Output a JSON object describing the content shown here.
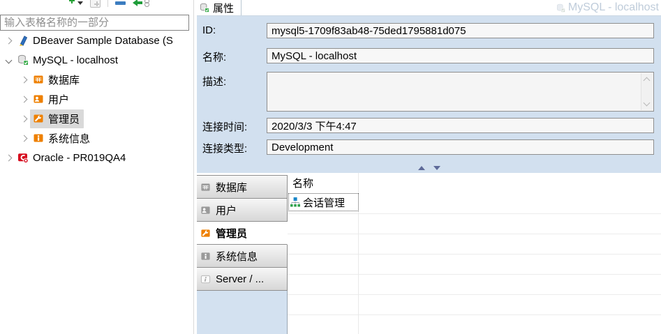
{
  "colors": {
    "panel_blue": "#d2e0ef",
    "accent_orange": "#ee8000",
    "selection_gray": "#d9d9d9",
    "oracle_red": "#d60a1d",
    "check_green": "#35aa47",
    "sitemap_blue": "#1b87c9",
    "sitemap_green": "#2fa14c",
    "field_bg": "#f7f7f7",
    "field_border": "#8f8f8f"
  },
  "sidebar": {
    "toolbar_icons": [
      "filter-add-icon",
      "menu-caret-icon",
      "new-item-icon",
      "collapse-all-icon",
      "back-arrow-icon",
      "link-with-editor-icon"
    ],
    "filter_placeholder": "输入表格名称的一部分",
    "tree": [
      {
        "label": "DBeaver Sample Database (S",
        "icon": "dbeaver-sample-db",
        "level": 0,
        "expanded": false,
        "selected": false
      },
      {
        "label": "MySQL - localhost",
        "icon": "mysql-connection-connected",
        "level": 0,
        "expanded": true,
        "selected": false
      },
      {
        "label": "数据库",
        "icon": "databases-folder",
        "level": 1,
        "expanded": false,
        "selected": false
      },
      {
        "label": "用户",
        "icon": "users-folder",
        "level": 1,
        "expanded": false,
        "selected": false
      },
      {
        "label": "管理员",
        "icon": "administer-folder",
        "level": 1,
        "expanded": false,
        "selected": true
      },
      {
        "label": "系统信息",
        "icon": "system-info-folder",
        "level": 1,
        "expanded": false,
        "selected": false
      },
      {
        "label": "Oracle - PR019QA4",
        "icon": "oracle-connection-error",
        "level": 0,
        "expanded": false,
        "selected": false
      }
    ]
  },
  "main": {
    "tab_label": "属性",
    "window_label": "MySQL - localhost",
    "form": {
      "id": {
        "label": "ID:",
        "value": "mysql5-1709f83ab48-75ded1795881d075"
      },
      "name": {
        "label": "名称:",
        "value": "MySQL - localhost"
      },
      "description": {
        "label": "描述:",
        "value": ""
      },
      "connect_time": {
        "label": "连接时间:",
        "value": "2020/3/3 下午4:47"
      },
      "connect_type": {
        "label": "连接类型:",
        "value": "Development"
      }
    },
    "bottom_tabs": [
      "数据库",
      "用户",
      "管理员",
      "系统信息",
      "Server / ..."
    ],
    "selected_bottom_tab": "管理员",
    "table": {
      "header_name": "名称",
      "row_session": "会话管理"
    }
  }
}
